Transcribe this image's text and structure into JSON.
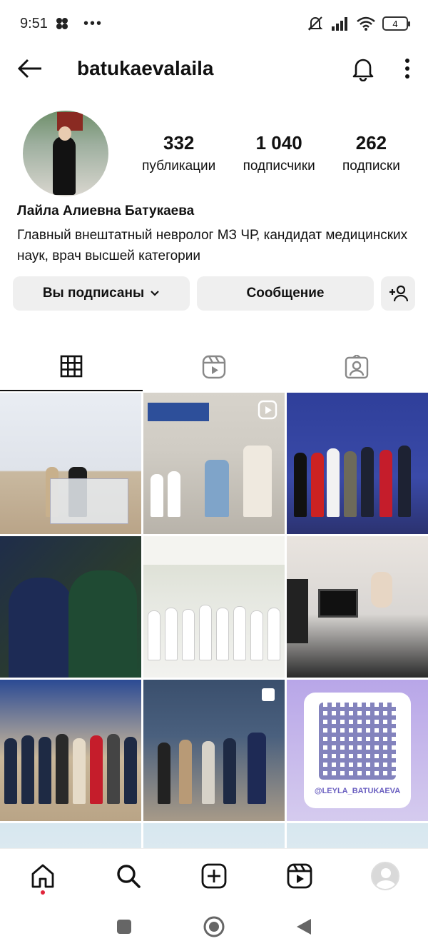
{
  "status_bar": {
    "time": "9:51",
    "dots": "•••",
    "battery": "4"
  },
  "header": {
    "username": "batukaevalaila"
  },
  "profile": {
    "stats": [
      {
        "value": "332",
        "label": "публикации"
      },
      {
        "value": "1 040",
        "label": "подписчики"
      },
      {
        "value": "262",
        "label": "подписки"
      }
    ],
    "name": "Лайла Алиевна Батукаева",
    "bio": "Главный внештатный невролог МЗ ЧР, кандидат медицинских наук, врач высшей категории"
  },
  "buttons": {
    "following": "Вы подписаны",
    "message": "Сообщение"
  },
  "posts": {
    "qr_handle": "@LEYLA_BATUKAEVA"
  },
  "colors": {
    "accent_dot": "#e0243a",
    "button_bg": "#efefef"
  },
  "icons": [
    "back-arrow-icon",
    "bell-icon",
    "more-vertical-icon",
    "chevron-down-icon",
    "add-person-icon",
    "grid-icon",
    "reels-icon",
    "tagged-icon",
    "home-icon",
    "search-icon",
    "create-icon",
    "reels-nav-icon"
  ]
}
